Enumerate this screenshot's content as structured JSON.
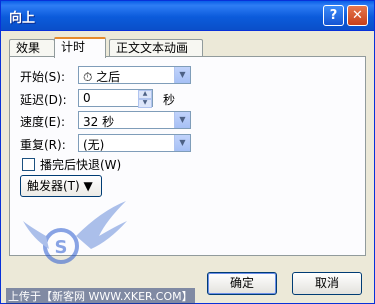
{
  "window": {
    "title": "向上",
    "help_icon": "?",
    "close_icon": "✕"
  },
  "tabs": [
    {
      "label": "效果"
    },
    {
      "label": "计时"
    },
    {
      "label": "正文文本动画"
    }
  ],
  "fields": {
    "start": {
      "label": "开始(S):",
      "value": "⏱ 之后"
    },
    "delay": {
      "label": "延迟(D):",
      "value": "0",
      "unit": "秒"
    },
    "speed": {
      "label": "速度(E):",
      "value": "32 秒"
    },
    "repeat": {
      "label": "重复(R):",
      "value": "(无)"
    },
    "rewind": {
      "label": "播完后快退(W)",
      "checked": false
    }
  },
  "trigger_button": "触发器(T) ▼",
  "buttons": {
    "ok": "确定",
    "cancel": "取消"
  },
  "watermark": {
    "credit": "上传于【新客网 WWW.XKER.COM】"
  },
  "colors": {
    "titlebar": "#0a5fe8",
    "dialog_bg": "#ece9d8",
    "tab_accent": "#e68b2c"
  }
}
